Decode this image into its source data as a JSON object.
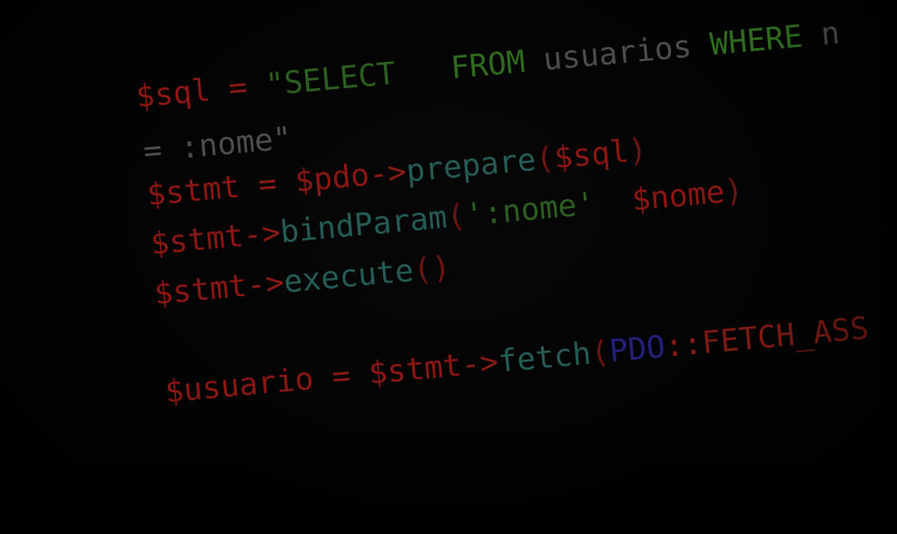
{
  "code_lines": [
    {
      "tokens": [
        {
          "text": "$sql",
          "kind": "var"
        },
        {
          "text": " = ",
          "kind": "op"
        },
        {
          "text": "\"SELECT   ",
          "kind": "str"
        },
        {
          "text": "FROM",
          "kind": "kw"
        },
        {
          "text": " usuarios ",
          "kind": "txt"
        },
        {
          "text": "WHERE",
          "kind": "kw"
        },
        {
          "text": " n",
          "kind": "txt"
        }
      ]
    },
    {
      "tokens": [
        {
          "text": "= :nome\"",
          "kind": "txt"
        }
      ]
    },
    {
      "tokens": [
        {
          "text": "$stmt",
          "kind": "var"
        },
        {
          "text": " = ",
          "kind": "op"
        },
        {
          "text": "$pdo",
          "kind": "var"
        },
        {
          "text": "->",
          "kind": "op"
        },
        {
          "text": "prepare",
          "kind": "fn"
        },
        {
          "text": "(",
          "kind": "paren"
        },
        {
          "text": "$sql",
          "kind": "var"
        },
        {
          "text": ")",
          "kind": "paren"
        }
      ]
    },
    {
      "tokens": [
        {
          "text": "$stmt",
          "kind": "var"
        },
        {
          "text": "->",
          "kind": "op"
        },
        {
          "text": "bindParam",
          "kind": "fn"
        },
        {
          "text": "(",
          "kind": "paren"
        },
        {
          "text": "':nome'  ",
          "kind": "str"
        },
        {
          "text": "$nome",
          "kind": "var"
        },
        {
          "text": ")",
          "kind": "paren"
        }
      ]
    },
    {
      "tokens": [
        {
          "text": "$stmt",
          "kind": "var"
        },
        {
          "text": "->",
          "kind": "op"
        },
        {
          "text": "execute",
          "kind": "fn"
        },
        {
          "text": "()",
          "kind": "paren"
        }
      ]
    },
    {
      "tokens": [
        {
          "text": "$usuario",
          "kind": "var"
        },
        {
          "text": " = ",
          "kind": "op"
        },
        {
          "text": "$stmt",
          "kind": "var"
        },
        {
          "text": "->",
          "kind": "op"
        },
        {
          "text": "fetch",
          "kind": "fn"
        },
        {
          "text": "(",
          "kind": "paren"
        },
        {
          "text": "PDO",
          "kind": "cls"
        },
        {
          "text": "::",
          "kind": "op"
        },
        {
          "text": "FETCH_ASS",
          "kind": "const"
        }
      ]
    }
  ],
  "colors": {
    "background": "#000000",
    "variable": "#8a1713",
    "string": "#2b5e1f",
    "keyword": "#2e6b1f",
    "function": "#245c55",
    "class": "#24207a"
  }
}
